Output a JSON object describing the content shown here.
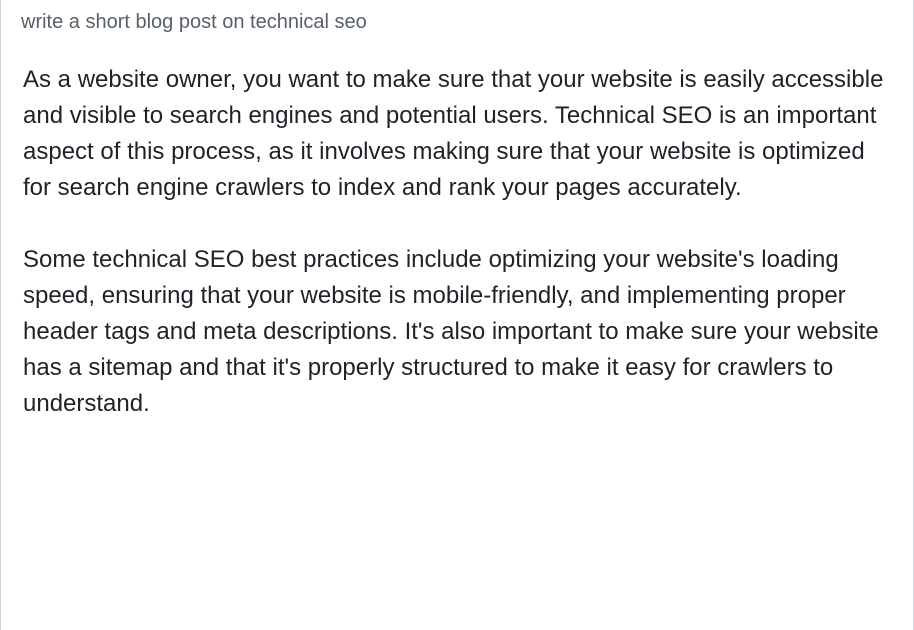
{
  "prompt": "write a short blog post on technical seo",
  "paragraphs": [
    "As a website owner, you want to make sure that your website is easily accessible and visible to search engines and potential users. Technical SEO is an important aspect of this process, as it involves making sure that your website is optimized for search engine crawlers to index and rank your pages accurately.",
    "Some technical SEO best practices include optimizing your website's loading speed, ensuring that your website is mobile-friendly, and implementing proper header tags and meta descriptions. It's also important to make sure your website has a sitemap and that it's properly structured to make it easy for crawlers to understand."
  ]
}
